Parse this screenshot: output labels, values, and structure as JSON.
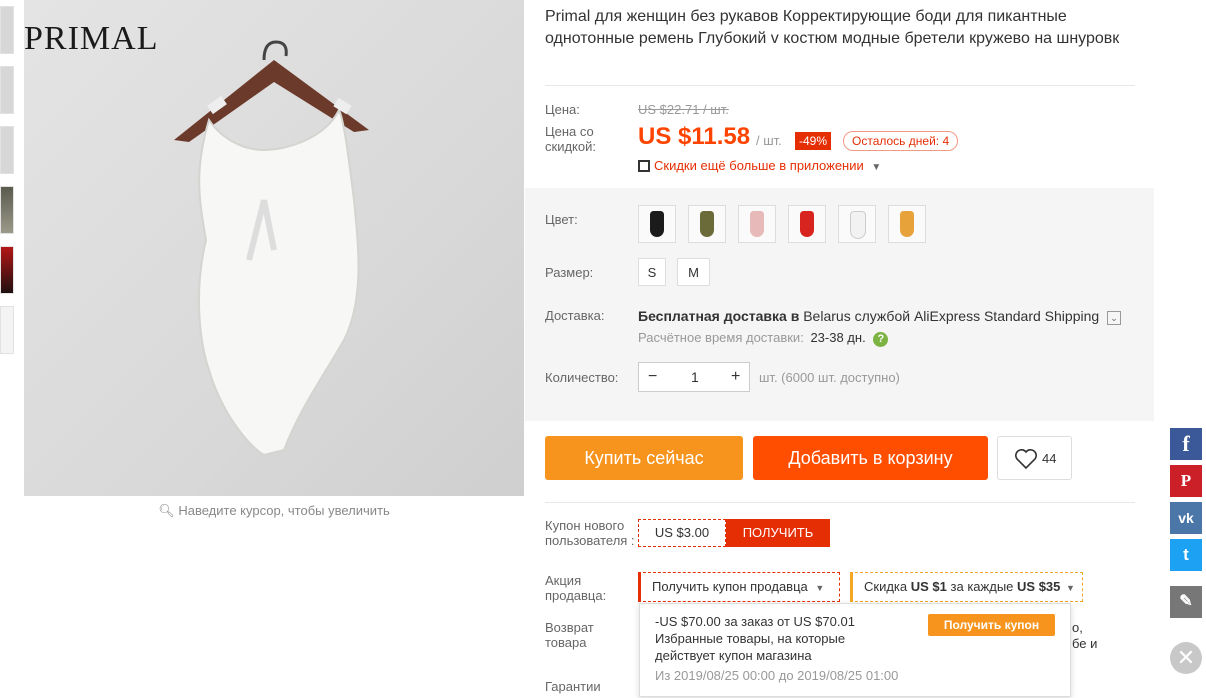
{
  "brand": "PRIMAL",
  "zoom_hint": "Наведите курсор, чтобы увеличить",
  "title": "Primal для женщин без рукавов Корректирующие боди для пикантные однотонные ремень Глубокий v костюм модные бретели кружево на шнуровк",
  "price": {
    "label": "Цена:",
    "old": "US $22.71 / шт.",
    "discount_label": "Цена со скидкой:",
    "current": "US $11.58",
    "unit": "/ шт.",
    "discount_badge": "-49%",
    "days_left": "Осталось дней: 4",
    "app_promo": "Скидки ещё больше в приложении"
  },
  "options": {
    "color_label": "Цвет:",
    "swatches": [
      "#1b1b1b",
      "#6b6b3a",
      "#e8b9b9",
      "#d8241e",
      "#f2f2f2",
      "#e8a23a"
    ],
    "size_label": "Размер:",
    "sizes": [
      "S",
      "M"
    ],
    "shipping_label": "Доставка:",
    "shipping_main_bold": "Бесплатная доставка в",
    "shipping_main_rest": "Belarus службой AliExpress Standard Shipping",
    "shipping_est_label": "Расчётное время доставки:",
    "shipping_est_value": "23-38 дн.",
    "qty_label": "Количество:",
    "qty_value": "1",
    "qty_note": "шт. (6000 шт. доступно)"
  },
  "actions": {
    "buy_now": "Купить сейчас",
    "add_to_cart": "Добавить в корзину",
    "wish_count": "44"
  },
  "coupons": {
    "new_user_label": "Купон нового пользователя :",
    "new_user_amount": "US $3.00",
    "get": "ПОЛУЧИТЬ",
    "seller_label": "Акция продавца:",
    "seller_coupon": "Получить купон продавца",
    "discount_pre": "Скидка",
    "discount_amt": "US $1",
    "discount_mid": "за каждые",
    "discount_thresh": "US $35",
    "return_label": "Возврат товара",
    "guarantee_label": "Гарантии",
    "right_snippet_1": "о,",
    "right_snippet_2": "бе и"
  },
  "popup": {
    "line1": "-US $70.00 за заказ от US $70.01",
    "line2": "Избранные товары, на которые",
    "line3": "действует купон магазина",
    "dates": "Из 2019/08/25 00:00 до 2019/08/25 01:00",
    "button": "Получить купон"
  },
  "social": {
    "facebook": "f",
    "pinterest": "P",
    "vk": "vk",
    "twitter": "t",
    "edit": "✎",
    "close": "✕"
  }
}
